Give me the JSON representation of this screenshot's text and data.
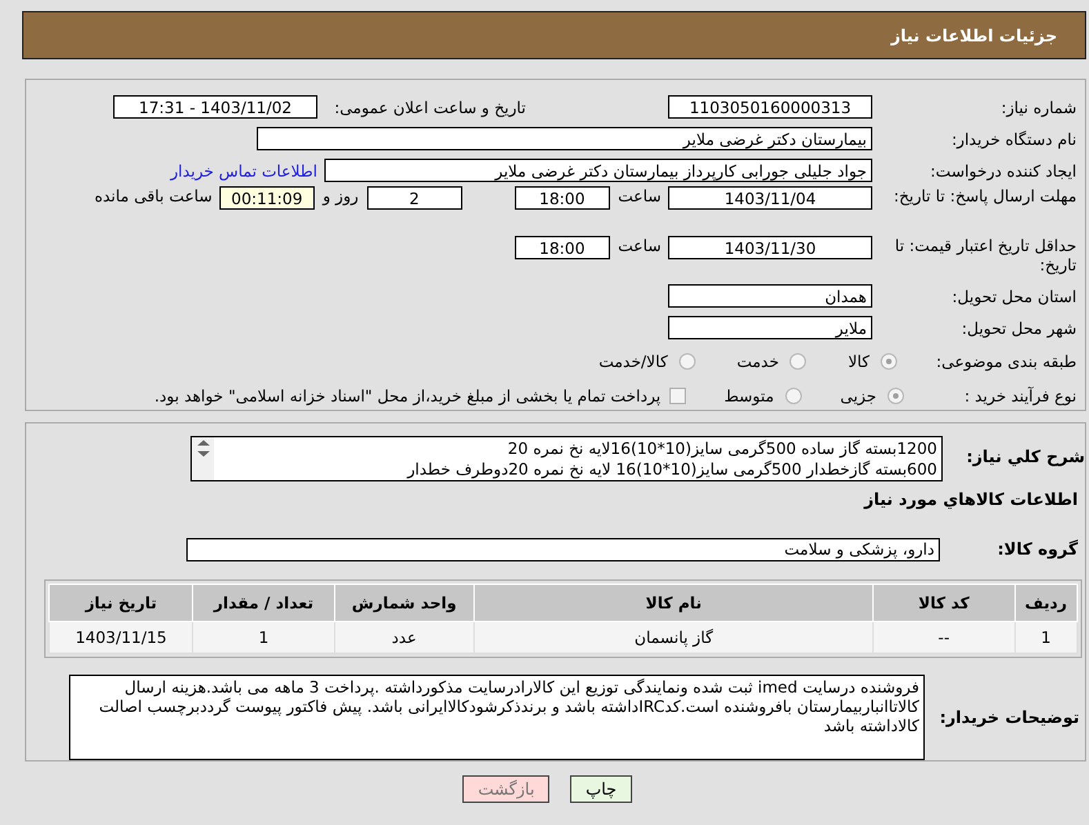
{
  "header": {
    "title": "جزئیات اطلاعات نیاز"
  },
  "need_number": {
    "label": "شماره نیاز:",
    "value": "1103050160000313"
  },
  "announce": {
    "label": "تاریخ و ساعت اعلان عمومی:",
    "value": "1403/11/02 - 17:31"
  },
  "buyer": {
    "label": "نام دستگاه خریدار:",
    "value": "بیمارستان دکتر غرضی ملایر"
  },
  "requester": {
    "label": "ایجاد کننده درخواست:",
    "value": "جواد جلیلی جورابی کارپرداز بیمارستان دکتر غرضی ملایر",
    "link": "اطلاعات تماس خریدار"
  },
  "reply_deadline": {
    "label": "مهلت ارسال پاسخ: تا تاریخ:",
    "date": "1403/11/04",
    "time_label": "ساعت",
    "time": "18:00",
    "days": "2",
    "days_label": "روز و",
    "remaining": "00:11:09",
    "remaining_label": "ساعت باقی مانده"
  },
  "price_validity": {
    "label": "حداقل تاریخ اعتبار قیمت: تا تاریخ:",
    "date": "1403/11/30",
    "time_label": "ساعت",
    "time": "18:00"
  },
  "province": {
    "label": "استان محل تحویل:",
    "value": "همدان"
  },
  "city": {
    "label": "شهر محل تحویل:",
    "value": "ملایر"
  },
  "category": {
    "label": "طبقه بندی موضوعی:",
    "options": [
      {
        "label": "کالا",
        "selected": true,
        "disabled": true
      },
      {
        "label": "خدمت",
        "selected": false,
        "disabled": true
      },
      {
        "label": "کالا/خدمت",
        "selected": false,
        "disabled": true
      }
    ]
  },
  "process": {
    "label": "نوع فرآیند خرید :",
    "options": [
      {
        "label": "جزیی",
        "selected": true,
        "disabled": true
      },
      {
        "label": "متوسط",
        "selected": false,
        "disabled": true
      }
    ],
    "payment": {
      "label": "پرداخت تمام یا بخشی از مبلغ خرید،از محل \"اسناد خزانه اسلامی\" خواهد بود.",
      "checked": false
    }
  },
  "description": {
    "label": "شرح کلي نياز:",
    "lines": [
      "1200بسته گاز ساده 500گرمی سایز(10*10)16لایه نخ نمره 20",
      "600بسته گازخطدار 500گرمی سایز(10*10)16 لایه نخ نمره 20دوطرف خطدار"
    ]
  },
  "goods_title": "اطلاعات کالاهاي مورد نياز",
  "goods_group": {
    "label": "گروه کالا:",
    "value": "دارو، پزشکی و سلامت"
  },
  "table": {
    "columns": [
      "ردیف",
      "کد کالا",
      "نام کالا",
      "واحد شمارش",
      "تعداد / مقدار",
      "تاریخ نیاز"
    ],
    "rows": [
      [
        "1",
        "--",
        "گاز پانسمان",
        "عدد",
        "1",
        "1403/11/15"
      ]
    ]
  },
  "buyer_notes": {
    "label": "توضیحات خریدار:",
    "value": "فروشنده درسایت imed ثبت شده ونمایندگی توزیع این کالارادرسایت مذکورداشته .پرداخت 3 ماهه می باشد.هزینه ارسال کالاتاانباربیمارستان بافروشنده است.کدIRCداشته باشد و برندذکرشودکالاایرانی باشد. پیش فاکتور پیوست گرددبرچسب اصالت کالاداشته باشد"
  },
  "buttons": [
    {
      "label": "چاپ",
      "kind": "print"
    },
    {
      "label": "بازگشت",
      "kind": "back"
    }
  ]
}
